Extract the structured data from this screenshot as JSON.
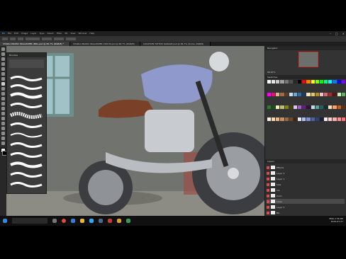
{
  "menubar": {
    "items": [
      "File",
      "Edit",
      "Image",
      "Layer",
      "Type",
      "Select",
      "Filter",
      "3D",
      "View",
      "Window",
      "Help"
    ]
  },
  "tabs": [
    {
      "label": "CHARLI DRAW2 WALLPAPER (MRL.psd @ 66.7% (RGB/8) *",
      "active": true
    },
    {
      "label": "CHARLI DRAW2 WALLPAPER 1256 B.psd @ 66.7% (RGB/8)",
      "active": false
    },
    {
      "label": "LOCATION TATTOO GARAGE.psd @ 66.7% (Some, RGB/8)",
      "active": false
    }
  ],
  "brushes": {
    "panel_title": "Brushes"
  },
  "status": {
    "zoom": "66%"
  },
  "navigator": {
    "title": "Navigator",
    "zoom": "66.67%"
  },
  "swatches": {
    "title": "Swatches"
  },
  "layers_panel": {
    "title": "Layers",
    "layers": [
      {
        "name": "Effects",
        "selected": false
      },
      {
        "name": "Layer 3",
        "selected": false
      },
      {
        "name": "Layer 1",
        "selected": false
      },
      {
        "name": "bike",
        "selected": false
      },
      {
        "name": "Ink",
        "selected": false
      },
      {
        "name": "Color",
        "selected": false
      },
      {
        "name": "Lines",
        "selected": true
      },
      {
        "name": "Layer 2",
        "selected": false
      },
      {
        "name": "BG",
        "selected": false
      },
      {
        "name": "Sketch",
        "selected": false
      }
    ]
  },
  "taskbar": {
    "time": "2:36 PM",
    "date": "2019-07-27",
    "lang": "ENG",
    "icons": [
      "start-icon",
      "search-icon",
      "taskview-icon",
      "chrome-icon",
      "edge-icon",
      "explorer-icon",
      "photoshop-icon",
      "steam-icon",
      "media-icon",
      "folder-icon",
      "app-icon"
    ]
  },
  "colors": {
    "wall": "#6f716c",
    "floor": "#8d8c84",
    "brick": "#9a4e46",
    "tank": "#8f99cc",
    "engine": "#c8cbcf",
    "tire": "#3b3d40",
    "seat": "#7a4028",
    "window_frame": "#6e8e8b",
    "window_glass": "#9fc3c6"
  },
  "swatch_colors": [
    "#ffffff",
    "#e6e6e6",
    "#c8c8c8",
    "#a0a0a0",
    "#787878",
    "#505050",
    "#282828",
    "#000000",
    "#ff0000",
    "#ff8000",
    "#ffff00",
    "#80ff00",
    "#00ff00",
    "#00ff80",
    "#00ffff",
    "#0080ff",
    "#0000ff",
    "#8000ff",
    "#ff00ff",
    "#ff0080",
    "#d9b38c",
    "#a66b3c",
    "#5c3a1e",
    "#c4e0f5",
    "#6aa8d8",
    "#2e6da4",
    "#1d3a5c",
    "#f5e6b8",
    "#e8c75a",
    "#b38f1c",
    "#f2c2c2",
    "#d46a6a",
    "#a02c2c",
    "#5c1414",
    "#c2f2c2",
    "#5ab35a",
    "#2c7a2c",
    "#145214",
    "#f0f0c0",
    "#c0c060",
    "#808020",
    "#404010",
    "#e0c0f0",
    "#a060c0",
    "#602080",
    "#301040",
    "#c0e0e0",
    "#60a0a0",
    "#206060",
    "#103030",
    "#ffe0c0",
    "#ffa060",
    "#c06020",
    "#603010",
    "#fef3e0",
    "#f7d9b0",
    "#e8b880",
    "#c99060",
    "#9c6a40",
    "#6e4828",
    "#3e2810",
    "#e0e8ff",
    "#b0c0f0",
    "#8090d0",
    "#5060a0",
    "#304070",
    "#182040",
    "#fff0f0",
    "#ffd0d0",
    "#ffb0b0",
    "#ff9090",
    "#ff7070"
  ]
}
